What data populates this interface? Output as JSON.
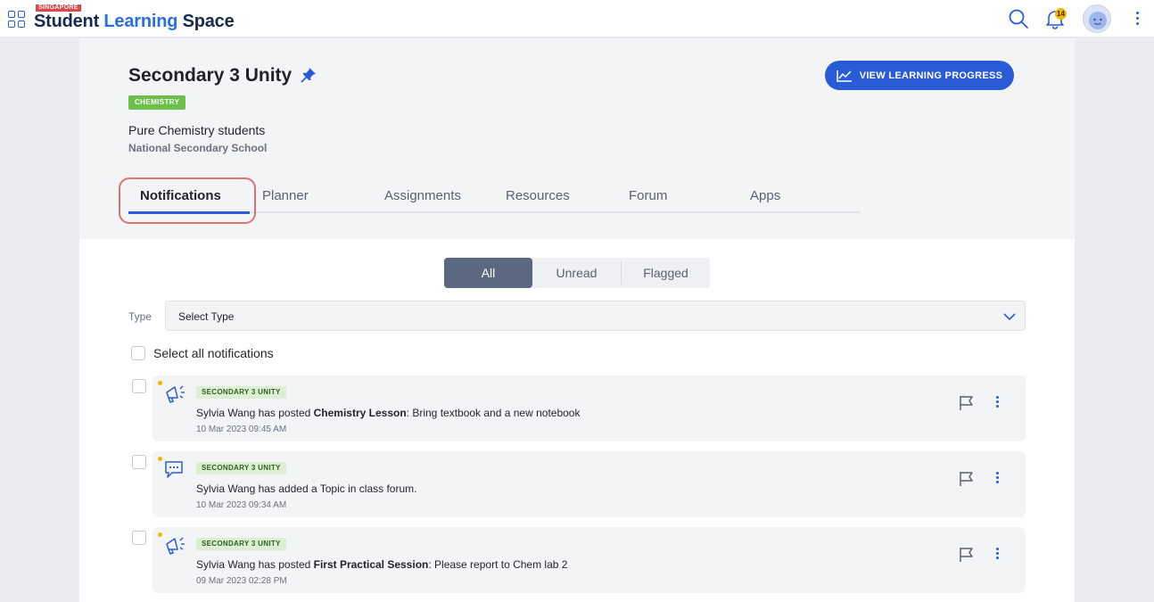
{
  "app": {
    "logo_badge": "SINGAPORE",
    "logo_part1": "Student ",
    "logo_part2": "Learning",
    "logo_part3": " Space",
    "notification_count": "14"
  },
  "class": {
    "title": "Secondary 3 Unity",
    "subject_tag": "CHEMISTRY",
    "description": "Pure Chemistry students",
    "school": "National Secondary School",
    "progress_button": "VIEW LEARNING PROGRESS"
  },
  "tabs": [
    {
      "label": "Notifications",
      "active": true
    },
    {
      "label": "Planner"
    },
    {
      "label": "Assignments"
    },
    {
      "label": "Resources"
    },
    {
      "label": "Forum"
    },
    {
      "label": "Apps"
    }
  ],
  "filter": {
    "options": [
      "All",
      "Unread",
      "Flagged"
    ],
    "selected": "All"
  },
  "type_filter": {
    "label": "Type",
    "value": "Select Type"
  },
  "select_all_label": "Select all notifications",
  "notifications": [
    {
      "icon": "megaphone-icon",
      "class_chip": "SECONDARY 3 UNITY",
      "prefix": "Sylvia Wang has posted ",
      "bold": "Chemistry Lesson",
      "suffix": ": Bring textbook and a new notebook",
      "time": "10 Mar 2023 09:45 AM",
      "unread": true
    },
    {
      "icon": "chat-icon",
      "class_chip": "SECONDARY 3 UNITY",
      "prefix": "Sylvia Wang has added a Topic in class forum.",
      "bold": "",
      "suffix": "",
      "time": "10 Mar 2023 09:34 AM",
      "unread": true
    },
    {
      "icon": "megaphone-icon",
      "class_chip": "SECONDARY 3 UNITY",
      "prefix": "Sylvia Wang has posted ",
      "bold": "First Practical Session",
      "suffix": ": Please report to Chem lab 2",
      "time": "09 Mar 2023 02:28 PM",
      "unread": true
    }
  ],
  "colors": {
    "accent": "#2a5bd7",
    "subject_tag": "#6cc04a",
    "unread_dot": "#f2b705",
    "segment_active": "#5a6882",
    "highlight_ring": "#e07070"
  }
}
